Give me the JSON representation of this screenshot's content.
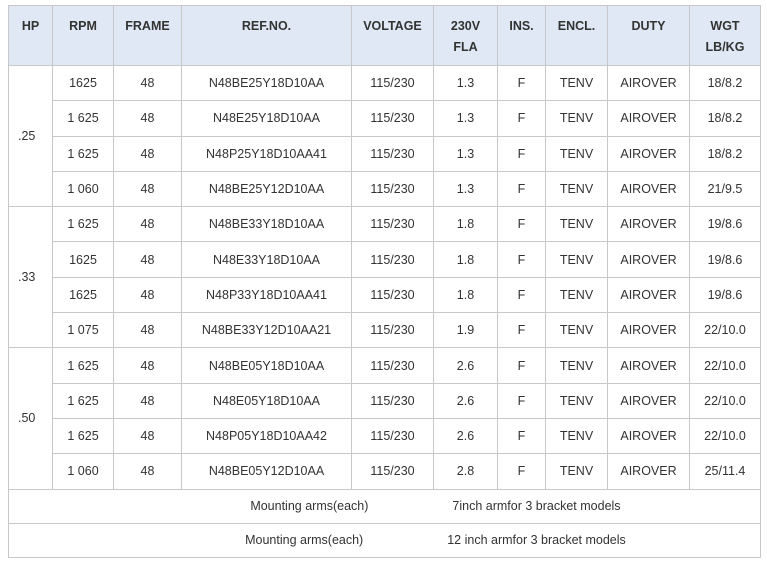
{
  "table": {
    "headers": [
      "HP",
      "RPM",
      "FRAME",
      "REF.NO.",
      "VOLTAGE",
      "230V\nFLA",
      "INS.",
      "ENCL.",
      "DUTY",
      "WGT\nLB/KG"
    ],
    "header_lines": [
      [
        "HP"
      ],
      [
        "RPM"
      ],
      [
        "FRAME"
      ],
      [
        "REF.NO."
      ],
      [
        "VOLTAGE"
      ],
      [
        "230V",
        "FLA"
      ],
      [
        "INS."
      ],
      [
        "ENCL."
      ],
      [
        "DUTY"
      ],
      [
        "WGT",
        "LB/KG"
      ]
    ],
    "groups": [
      {
        "hp": ".25",
        "rows": [
          [
            "1625",
            "48",
            "N48BE25Y18D10AA",
            "115/230",
            "1.3",
            "F",
            "TENV",
            "AIROVER",
            "18/8.2"
          ],
          [
            "1 625",
            "48",
            "N48E25Y18D10AA",
            "115/230",
            "1.3",
            "F",
            "TENV",
            "AIROVER",
            "18/8.2"
          ],
          [
            "1 625",
            "48",
            "N48P25Y18D10AA41",
            "115/230",
            "1.3",
            "F",
            "TENV",
            "AIROVER",
            "18/8.2"
          ],
          [
            "1 060",
            "48",
            "N48BE25Y12D10AA",
            "115/230",
            "1.3",
            "F",
            "TENV",
            "AIROVER",
            "21/9.5"
          ]
        ]
      },
      {
        "hp": ".33",
        "rows": [
          [
            "1 625",
            "48",
            "N48BE33Y18D10AA",
            "115/230",
            "1.8",
            "F",
            "TENV",
            "AIROVER",
            "19/8.6"
          ],
          [
            "1625",
            "48",
            "N48E33Y18D10AA",
            "115/230",
            "1.8",
            "F",
            "TENV",
            "AIROVER",
            "19/8.6"
          ],
          [
            "1625",
            "48",
            "N48P33Y18D10AA41",
            "115/230",
            "1.8",
            "F",
            "TENV",
            "AIROVER",
            "19/8.6"
          ],
          [
            "1 075",
            "48",
            "N48BE33Y12D10AA21",
            "115/230",
            "1.9",
            "F",
            "TENV",
            "AIROVER",
            "22/10.0"
          ]
        ]
      },
      {
        "hp": ".50",
        "rows": [
          [
            "1 625",
            "48",
            "N48BE05Y18D10AA",
            "115/230",
            "2.6",
            "F",
            "TENV",
            "AIROVER",
            "22/10.0"
          ],
          [
            "1 625",
            "48",
            "N48E05Y18D10AA",
            "115/230",
            "2.6",
            "F",
            "TENV",
            "AIROVER",
            "22/10.0"
          ],
          [
            "1 625",
            "48",
            "N48P05Y18D10AA42",
            "115/230",
            "2.6",
            "F",
            "TENV",
            "AIROVER",
            "22/10.0"
          ],
          [
            "1 060",
            "48",
            "N48BE05Y12D10AA",
            "115/230",
            "2.8",
            "F",
            "TENV",
            "AIROVER",
            "25/11.4"
          ]
        ]
      }
    ],
    "notes": [
      {
        "label": "Mounting arms(each)",
        "value": "7inch armfor 3 bracket models"
      },
      {
        "label": "Mounting arms(each)",
        "value": "12 inch armfor 3 bracket models"
      }
    ]
  },
  "colors": {
    "header_bg": "#dfe8f4",
    "border": "#c8c8c8",
    "text": "#333333"
  }
}
